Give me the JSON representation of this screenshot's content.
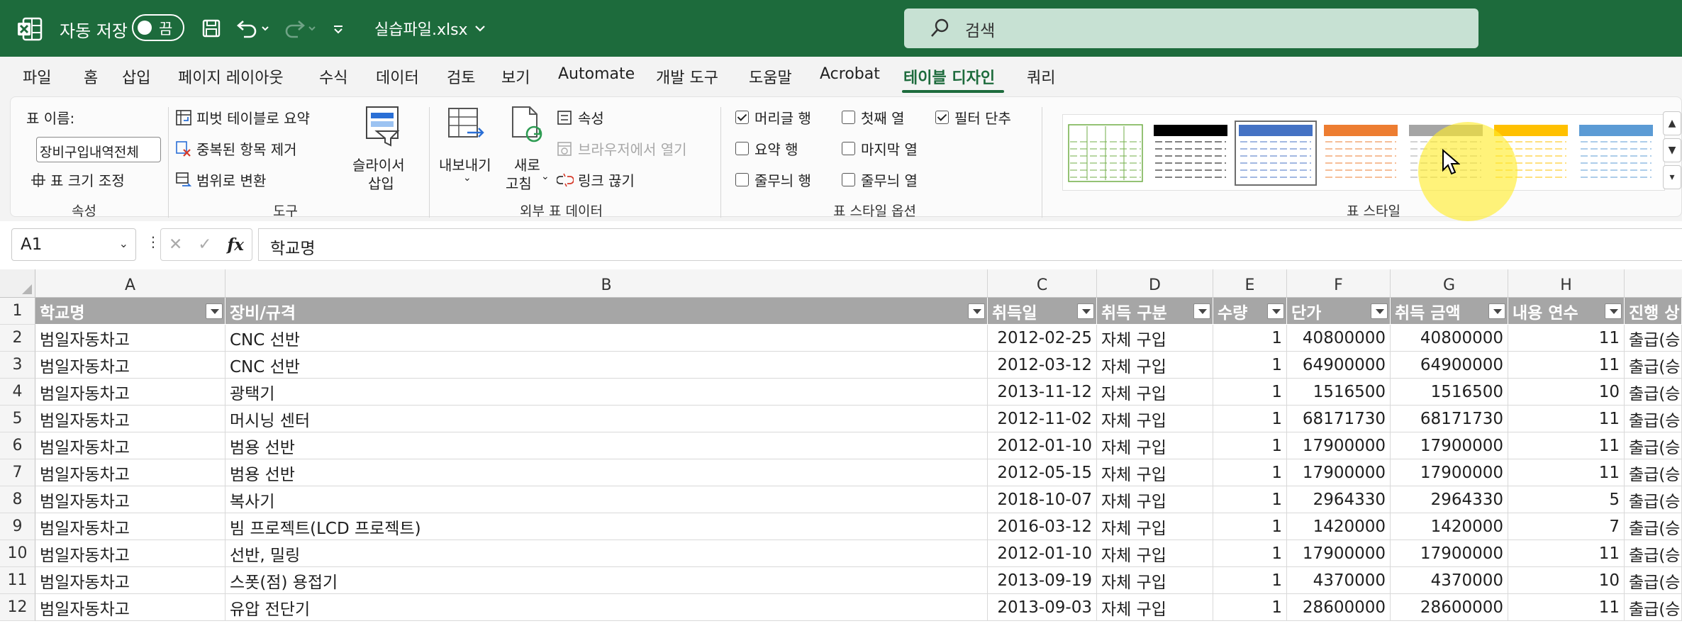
{
  "titlebar": {
    "autosave_label": "자동 저장",
    "autosave_state": "끔",
    "file_name": "실습파일.xlsx",
    "search_placeholder": "검색",
    "bg_color": "#1d6b3c"
  },
  "menu": {
    "items": [
      "파일",
      "홈",
      "삽입",
      "페이지 레이아웃",
      "수식",
      "데이터",
      "검토",
      "보기",
      "Automate",
      "개발 도구",
      "도움말",
      "Acrobat",
      "테이블 디자인",
      "쿼리"
    ],
    "active": "테이블 디자인"
  },
  "ribbon": {
    "properties": {
      "table_name_label": "표 이름:",
      "table_name_value": "장비구입내역전체",
      "resize": "표 크기 조정",
      "group": "속성"
    },
    "tools": {
      "pivot": "피벗 테이블로 요약",
      "remove_dup": "중복된 항목 제거",
      "convert": "범위로 변환",
      "slicer_line1": "슬라이서",
      "slicer_line2": "삽입",
      "group": "도구"
    },
    "external": {
      "export": "내보내기",
      "refresh_line1": "새로",
      "refresh_line2": "고침",
      "properties": "속성",
      "open_browser": "브라우저에서 열기",
      "unlink": "링크 끊기",
      "group": "외부 표 데이터"
    },
    "style_options": {
      "header_row": "머리글 행",
      "first_col": "첫째 열",
      "filter_btn": "필터 단추",
      "total_row": "요약 행",
      "last_col": "마지막 열",
      "banded_rows": "줄무늬 행",
      "banded_cols": "줄무늬 열",
      "group": "표 스타일 옵션"
    },
    "checked": {
      "header_row": true,
      "first_col": false,
      "filter_btn": true,
      "total_row": false,
      "last_col": false,
      "banded_rows": false,
      "banded_cols": false
    },
    "styles": {
      "group": "표 스타일",
      "swatch_colors": [
        "#70ad47",
        "#000000",
        "#4472c4",
        "#ed7d31",
        "#a5a5a5",
        "#ffc000",
        "#5b9bd5"
      ]
    }
  },
  "formula": {
    "cell_ref": "A1",
    "fx": "fx",
    "content": "학교명"
  },
  "columns": [
    "A",
    "B",
    "C",
    "D",
    "E",
    "F",
    "G",
    "H"
  ],
  "headers": [
    "학교명",
    "장비/규격",
    "취득일",
    "취득 구분",
    "수량",
    "단가",
    "취득 금액",
    "내용 연수",
    "진행 상"
  ],
  "rows": [
    {
      "n": "2",
      "a": "범일자동차고",
      "b": "CNC 선반",
      "c": "2012-02-25",
      "d": "자체 구입",
      "e": "1",
      "f": "40800000",
      "g": "40800000",
      "h": "11",
      "i": "출급(승"
    },
    {
      "n": "3",
      "a": "범일자동차고",
      "b": "CNC 선반",
      "c": "2012-03-12",
      "d": "자체 구입",
      "e": "1",
      "f": "64900000",
      "g": "64900000",
      "h": "11",
      "i": "출급(승"
    },
    {
      "n": "4",
      "a": "범일자동차고",
      "b": "광택기",
      "c": "2013-11-12",
      "d": "자체 구입",
      "e": "1",
      "f": "1516500",
      "g": "1516500",
      "h": "10",
      "i": "출급(승"
    },
    {
      "n": "5",
      "a": "범일자동차고",
      "b": "머시닝 센터",
      "c": "2012-11-02",
      "d": "자체 구입",
      "e": "1",
      "f": "68171730",
      "g": "68171730",
      "h": "11",
      "i": "출급(승"
    },
    {
      "n": "6",
      "a": "범일자동차고",
      "b": "범용 선반",
      "c": "2012-01-10",
      "d": "자체 구입",
      "e": "1",
      "f": "17900000",
      "g": "17900000",
      "h": "11",
      "i": "출급(승"
    },
    {
      "n": "7",
      "a": "범일자동차고",
      "b": "범용 선반",
      "c": "2012-05-15",
      "d": "자체 구입",
      "e": "1",
      "f": "17900000",
      "g": "17900000",
      "h": "11",
      "i": "출급(승"
    },
    {
      "n": "8",
      "a": "범일자동차고",
      "b": "복사기",
      "c": "2018-10-07",
      "d": "자체 구입",
      "e": "1",
      "f": "2964330",
      "g": "2964330",
      "h": "5",
      "i": "출급(승"
    },
    {
      "n": "9",
      "a": "범일자동차고",
      "b": "빔 프로젝트(LCD 프로젝트)",
      "c": "2016-03-12",
      "d": "자체 구입",
      "e": "1",
      "f": "1420000",
      "g": "1420000",
      "h": "7",
      "i": "출급(승"
    },
    {
      "n": "10",
      "a": "범일자동차고",
      "b": "선반, 밀링",
      "c": "2012-01-10",
      "d": "자체 구입",
      "e": "1",
      "f": "17900000",
      "g": "17900000",
      "h": "11",
      "i": "출급(승"
    },
    {
      "n": "11",
      "a": "범일자동차고",
      "b": "스폿(점) 용접기",
      "c": "2013-09-19",
      "d": "자체 구입",
      "e": "1",
      "f": "4370000",
      "g": "4370000",
      "h": "10",
      "i": "출급(승"
    },
    {
      "n": "12",
      "a": "범일자동차고",
      "b": "유압 전단기",
      "c": "2013-09-03",
      "d": "자체 구입",
      "e": "1",
      "f": "28600000",
      "g": "28600000",
      "h": "11",
      "i": "출급(승"
    }
  ]
}
